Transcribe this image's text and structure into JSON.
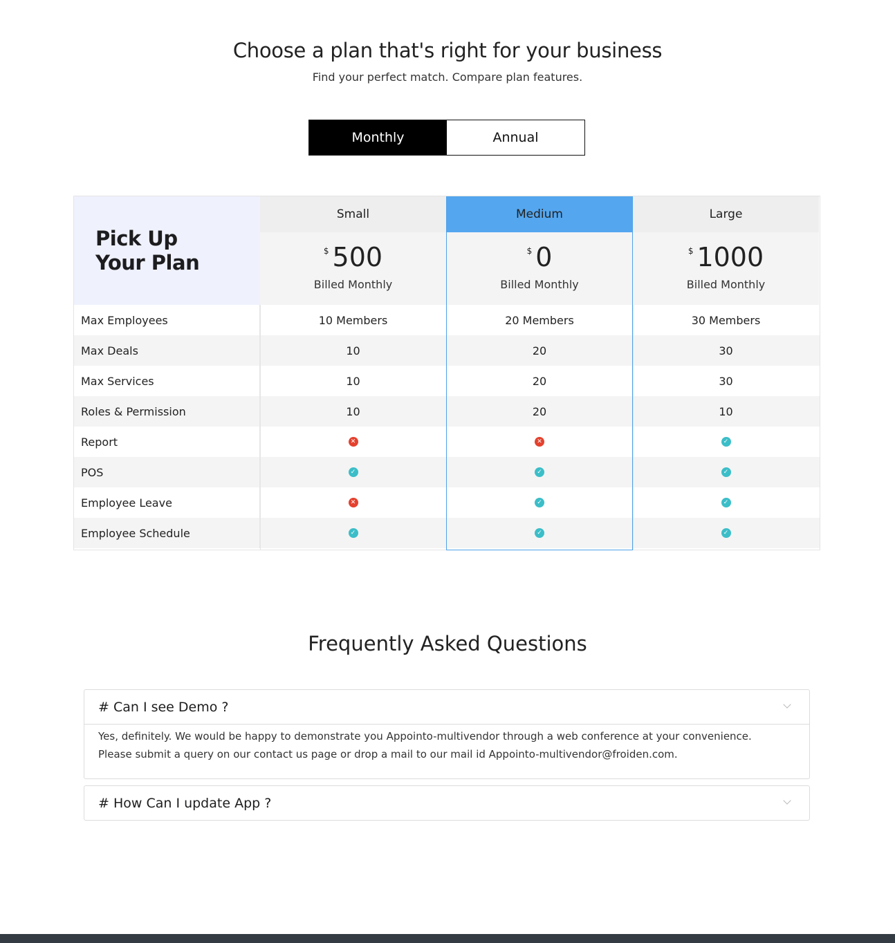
{
  "header": {
    "title": "Choose a plan that's right for your business",
    "subtitle": "Find your perfect match. Compare plan features."
  },
  "billing_toggle": {
    "monthly": "Monthly",
    "annual": "Annual",
    "selected": "Monthly"
  },
  "pricing": {
    "pick_line1": "Pick Up",
    "pick_line2": "Your Plan",
    "plans": [
      {
        "name": "Small",
        "currency": "$",
        "price": "500",
        "billing": "Billed Monthly"
      },
      {
        "name": "Medium",
        "currency": "$",
        "price": "0",
        "billing": "Billed Monthly",
        "highlighted": true
      },
      {
        "name": "Large",
        "currency": "$",
        "price": "1000",
        "billing": "Billed Monthly"
      }
    ],
    "features": [
      {
        "label": "Max Employees",
        "values": [
          "10 Members",
          "20 Members",
          "30 Members"
        ]
      },
      {
        "label": "Max Deals",
        "values": [
          "10",
          "20",
          "30"
        ]
      },
      {
        "label": "Max Services",
        "values": [
          "10",
          "20",
          "30"
        ]
      },
      {
        "label": "Roles & Permission",
        "values": [
          "10",
          "20",
          "10"
        ]
      },
      {
        "label": "Report",
        "values": [
          false,
          false,
          true
        ]
      },
      {
        "label": "POS",
        "values": [
          true,
          true,
          true
        ]
      },
      {
        "label": "Employee Leave",
        "values": [
          false,
          true,
          true
        ]
      },
      {
        "label": "Employee Schedule",
        "values": [
          true,
          true,
          true
        ]
      }
    ],
    "colors": {
      "highlight": "#54a6ee",
      "check": "#3cbec9",
      "cross": "#e4422f"
    }
  },
  "faq": {
    "title": "Frequently Asked Questions",
    "items": [
      {
        "question": "# Can I see Demo ?",
        "answer": "Yes, definitely. We would be happy to demonstrate you Appointo-multivendor through a web conference at your convenience. Please submit a query on our contact us page or drop a mail to our mail id Appointo-multivendor@froiden.com.",
        "expanded": true
      },
      {
        "question": "# How Can I update App ?",
        "expanded": false
      }
    ]
  }
}
